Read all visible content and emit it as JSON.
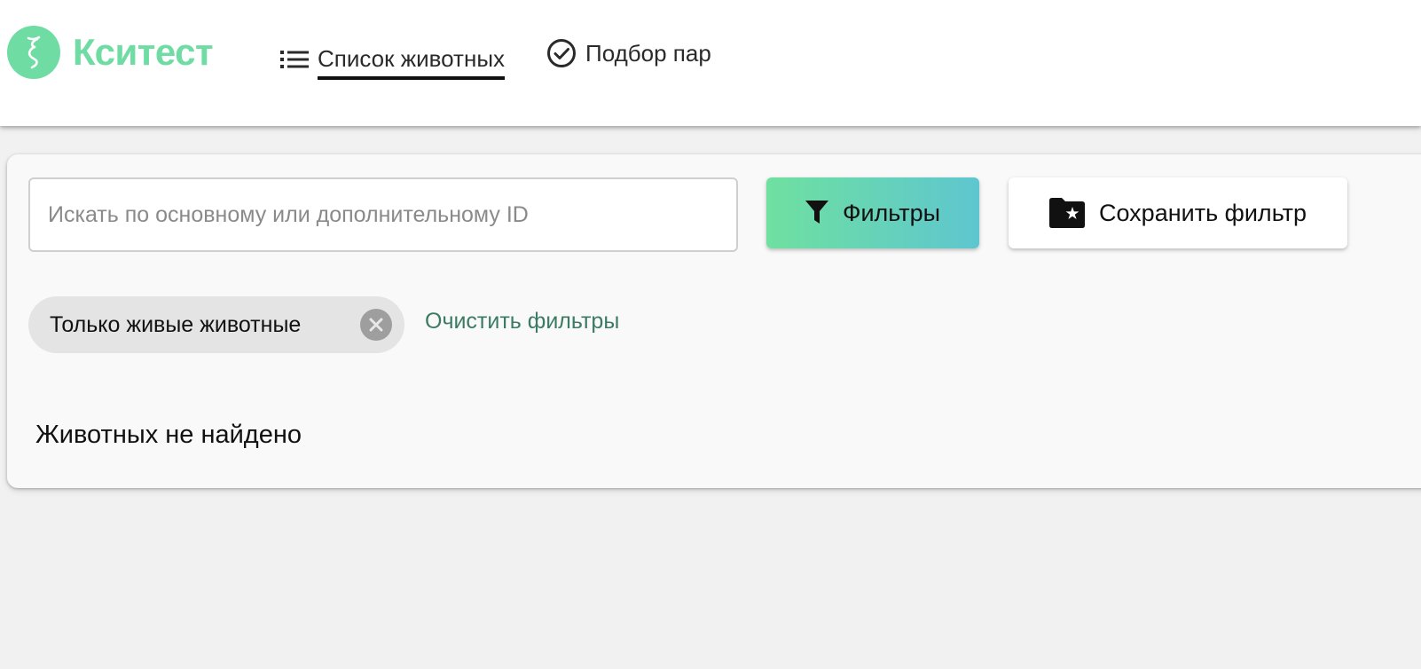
{
  "header": {
    "logo_text": "Кситест",
    "logo_icon": "xi-icon",
    "nav": [
      {
        "label": "Список животных",
        "icon": "list-icon",
        "active": true
      },
      {
        "label": "Подбор пар",
        "icon": "check-circle-icon",
        "active": false
      }
    ]
  },
  "search": {
    "placeholder": "Искать по основному или дополнительному ID",
    "value": ""
  },
  "toolbar": {
    "filters_label": "Фильтры",
    "filters_icon": "filter-icon",
    "save_filter_label": "Сохранить фильтр",
    "save_filter_icon": "folder-star-icon"
  },
  "active_filters": [
    {
      "label": "Только живые животные"
    }
  ],
  "clear_filters_label": "Очистить фильтры",
  "empty_message": "Животных не найдено",
  "colors": {
    "brand": "#6fdca3",
    "button_gradient_start": "#6fe0a0",
    "button_gradient_end": "#5ec6cf",
    "link": "#3b7b63",
    "page_bg": "#f1f1f1"
  }
}
